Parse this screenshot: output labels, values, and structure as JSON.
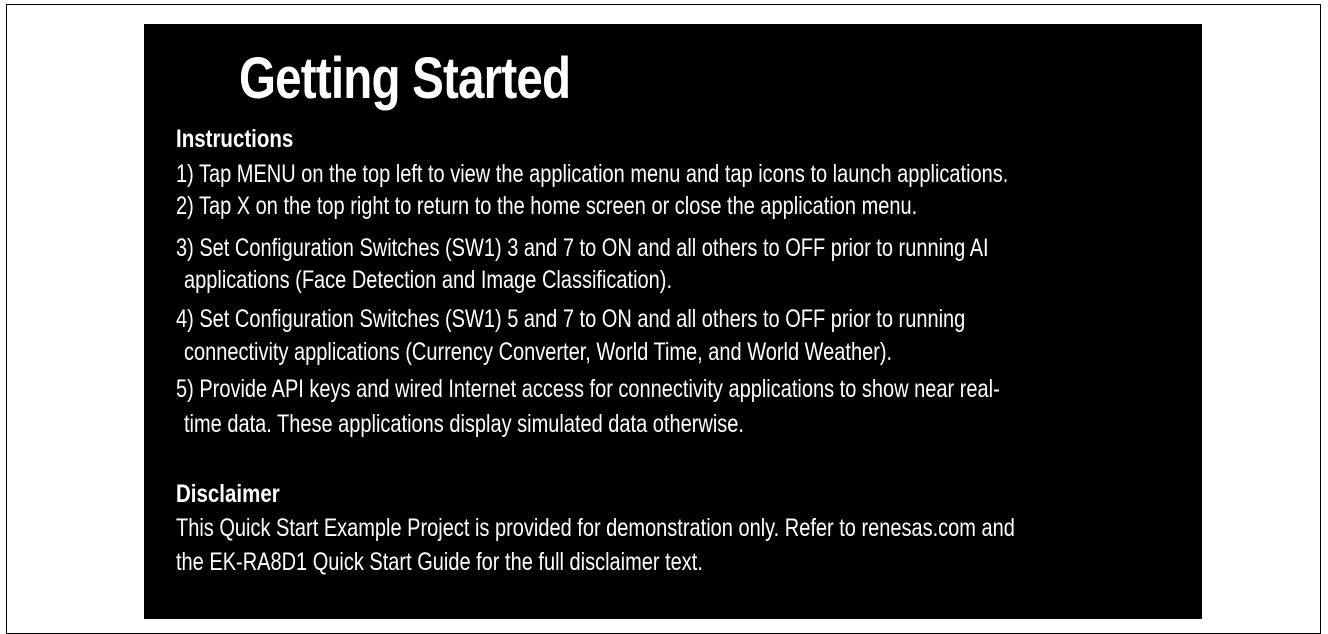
{
  "title": "Getting Started",
  "instructions": {
    "heading": "Instructions",
    "lines": [
      "1) Tap MENU on the top left to view the application menu and tap icons to launch applications.",
      "2) Tap X on the top right to return to the home screen or close the application menu.",
      "3) Set Configuration Switches (SW1) 3 and 7 to ON and all others to OFF prior to running AI",
      "applications (Face Detection and Image Classification).",
      "4) Set Configuration Switches (SW1) 5 and 7 to ON and all others to OFF prior to running",
      "connectivity applications (Currency Converter, World Time, and World Weather).",
      "5) Provide API keys and wired Internet access for connectivity applications to show near real-",
      "time data. These applications display simulated data otherwise."
    ]
  },
  "disclaimer": {
    "heading": "Disclaimer",
    "lines": [
      "This Quick Start Example Project is provided for demonstration only. Refer to renesas.com and",
      "the EK-RA8D1 Quick Start Guide for the full disclaimer text."
    ]
  },
  "colors": {
    "screen_background": "#000000",
    "text": "#ffffff",
    "page_background": "#ffffff"
  }
}
